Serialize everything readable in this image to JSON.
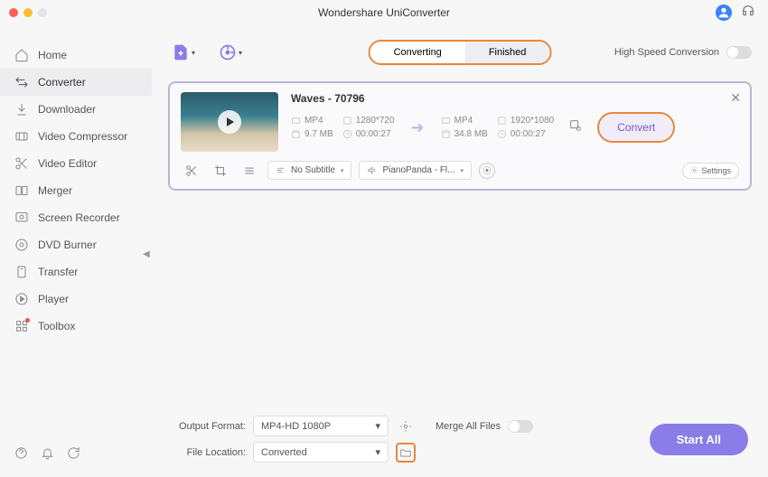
{
  "titlebar": {
    "title": "Wondershare UniConverter"
  },
  "sidebar": {
    "items": [
      {
        "label": "Home",
        "icon": "home"
      },
      {
        "label": "Converter",
        "icon": "converter",
        "active": true
      },
      {
        "label": "Downloader",
        "icon": "download"
      },
      {
        "label": "Video Compressor",
        "icon": "compress"
      },
      {
        "label": "Video Editor",
        "icon": "scissors"
      },
      {
        "label": "Merger",
        "icon": "merger"
      },
      {
        "label": "Screen Recorder",
        "icon": "record"
      },
      {
        "label": "DVD Burner",
        "icon": "disc"
      },
      {
        "label": "Transfer",
        "icon": "transfer"
      },
      {
        "label": "Player",
        "icon": "play"
      },
      {
        "label": "Toolbox",
        "icon": "grid",
        "dot": true
      }
    ]
  },
  "toolbar": {
    "tabs": {
      "converting": "Converting",
      "finished": "Finished"
    },
    "hsc_label": "High Speed Conversion"
  },
  "item": {
    "filename": "Waves - 70796",
    "src": {
      "format": "MP4",
      "size": "9.7 MB",
      "res": "1280*720",
      "dur": "00:00:27"
    },
    "dst": {
      "format": "MP4",
      "size": "34.8 MB",
      "res": "1920*1080",
      "dur": "00:00:27"
    },
    "convert_label": "Convert",
    "subtitle": "No Subtitle",
    "audio": "PianoPanda - Fl...",
    "settings_label": "Settings"
  },
  "footer": {
    "output_format_label": "Output Format:",
    "output_format_value": "MP4-HD 1080P",
    "file_location_label": "File Location:",
    "file_location_value": "Converted",
    "merge_label": "Merge All Files",
    "start_all": "Start All"
  }
}
